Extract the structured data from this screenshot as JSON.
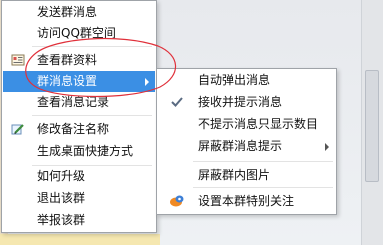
{
  "main_menu": {
    "items": [
      {
        "label": "发送群消息"
      },
      {
        "label": "访问QQ群空间"
      },
      {
        "label": "查看群资料",
        "icon": "group-info-icon"
      },
      {
        "label": "群消息设置",
        "selected": true,
        "has_submenu": true
      },
      {
        "label": "查看消息记录"
      },
      {
        "label": "修改备注名称",
        "icon": "edit-pencil-icon"
      },
      {
        "label": "生成桌面快捷方式"
      },
      {
        "label": "如何升级"
      },
      {
        "label": "退出该群"
      },
      {
        "label": "举报该群"
      }
    ]
  },
  "submenu": {
    "items": [
      {
        "label": "自动弹出消息"
      },
      {
        "label": "接收并提示消息",
        "checked": true
      },
      {
        "label": "不提示消息只显示数目"
      },
      {
        "label": "屏蔽群消息提示",
        "has_submenu": true
      },
      {
        "label": "屏蔽群内图片"
      },
      {
        "label": "设置本群特别关注",
        "icon": "special-attention-icon"
      }
    ]
  },
  "colors": {
    "selection": "#3b8fe4",
    "annotation": "#e0303a"
  }
}
